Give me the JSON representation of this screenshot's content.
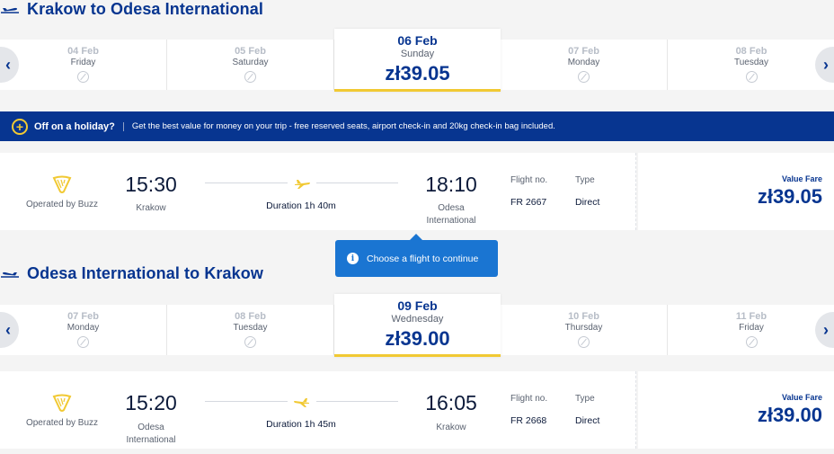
{
  "colors": {
    "brand": "#073590",
    "accent": "#f1c933",
    "info": "#1a75d2"
  },
  "outbound": {
    "title": "Krakow to Odesa International",
    "days": [
      {
        "date": "04 Feb",
        "weekday": "Friday",
        "price": ""
      },
      {
        "date": "05 Feb",
        "weekday": "Saturday",
        "price": ""
      },
      {
        "date": "06 Feb",
        "weekday": "Sunday",
        "price": "zł39.05"
      },
      {
        "date": "07 Feb",
        "weekday": "Monday",
        "price": ""
      },
      {
        "date": "08 Feb",
        "weekday": "Tuesday",
        "price": ""
      }
    ],
    "flight": {
      "operated_by": "Operated by Buzz",
      "depart_time": "15:30",
      "depart_place": "Krakow",
      "duration": "Duration 1h 40m",
      "arrive_time": "18:10",
      "arrive_place_line1": "Odesa",
      "arrive_place_line2": "International",
      "flight_no_label": "Flight no.",
      "flight_no": "FR 2667",
      "type_label": "Type",
      "type": "Direct",
      "fare_type": "Value Fare",
      "fare_price": "zł39.05"
    }
  },
  "banner": {
    "title": "Off on a holiday?",
    "description": "Get the best value for money on your trip - free reserved seats, airport check-in and 20kg check-in bag included."
  },
  "tooltip": {
    "text": "Choose a flight to continue"
  },
  "inbound": {
    "title": "Odesa International to Krakow",
    "days": [
      {
        "date": "07 Feb",
        "weekday": "Monday",
        "price": ""
      },
      {
        "date": "08 Feb",
        "weekday": "Tuesday",
        "price": ""
      },
      {
        "date": "09 Feb",
        "weekday": "Wednesday",
        "price": "zł39.00"
      },
      {
        "date": "10 Feb",
        "weekday": "Thursday",
        "price": ""
      },
      {
        "date": "11 Feb",
        "weekday": "Friday",
        "price": ""
      }
    ],
    "flight": {
      "operated_by": "Operated by Buzz",
      "depart_time": "15:20",
      "depart_place_line1": "Odesa",
      "depart_place_line2": "International",
      "duration": "Duration 1h 45m",
      "arrive_time": "16:05",
      "arrive_place": "Krakow",
      "flight_no_label": "Flight no.",
      "flight_no": "FR 2668",
      "type_label": "Type",
      "type": "Direct",
      "fare_type": "Value Fare",
      "fare_price": "zł39.00"
    }
  }
}
